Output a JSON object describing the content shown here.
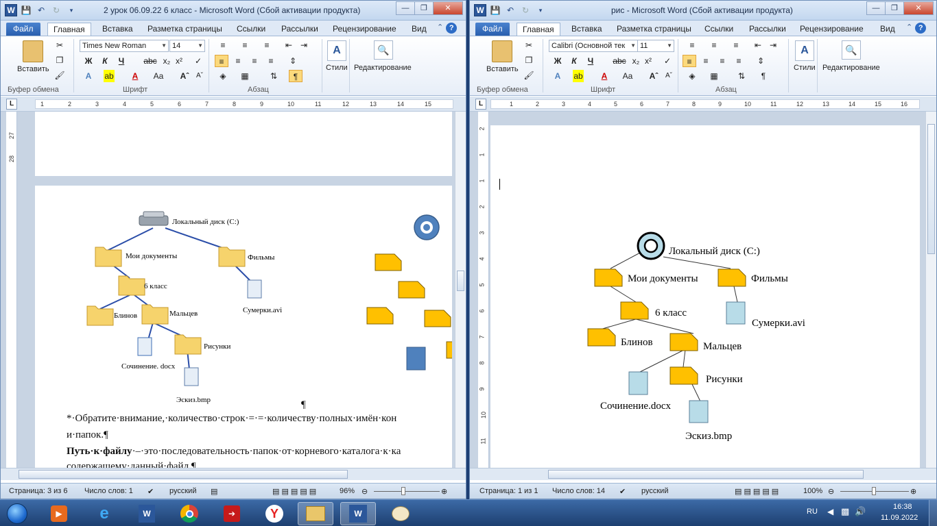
{
  "left_window": {
    "title": "2 урок 06.09.22  6 класс  -  Microsoft Word (Сбой активации продукта)",
    "tabs": [
      "Файл",
      "Главная",
      "Вставка",
      "Разметка страницы",
      "Ссылки",
      "Рассылки",
      "Рецензирование",
      "Вид"
    ],
    "active_tab": "Главная",
    "font_name": "Times New Roman",
    "font_size": "14",
    "groups": [
      "Буфер обмена",
      "Шрифт",
      "Абзац"
    ],
    "paste_label": "Вставить",
    "styles_label": "Стили",
    "editing_label": "Редактирование",
    "ruler_numbers": [
      "1",
      "2",
      "3",
      "4",
      "5",
      "6",
      "7",
      "8",
      "9",
      "10",
      "11",
      "12",
      "13",
      "14",
      "15"
    ],
    "vruler_numbers": [
      "27",
      "28"
    ],
    "diagram_labels": {
      "disk": "Локальный диск (C:)",
      "docs": "Мои документы",
      "films": "Фильмы",
      "class6": "6 класс",
      "blinov": "Блинов",
      "maltsev": "Мальцев",
      "sumerki": "Сумерки.avi",
      "sochinenie": "Сочинение. docx",
      "risunki": "Рисунки",
      "eskiz": "Эскиз.bmp"
    },
    "pilcrow": "¶",
    "doc_line1": "*·Обратите·внимание,·количество·строк·=·=·количеству·полных·имён·кон",
    "doc_line2": "и·папок.¶",
    "doc_line3_bold": "Путь·к·файлу",
    "doc_line3_rest": "·–·это·последовательность·папок·от·корневого·каталога·к·ка",
    "doc_line4": "содержащему·данный·файл.¶",
    "status": {
      "page": "Страница: 3 из 6",
      "words": "Число слов: 1",
      "lang": "русский",
      "zoom": "96%"
    }
  },
  "right_window": {
    "title": "рис  -  Microsoft Word (Сбой активации продукта)",
    "tabs": [
      "Файл",
      "Главная",
      "Вставка",
      "Разметка страницы",
      "Ссылки",
      "Рассылки",
      "Рецензирование",
      "Вид"
    ],
    "active_tab": "Главная",
    "font_name": "Calibri (Основной тек",
    "font_size": "11",
    "groups": [
      "Буфер обмена",
      "Шрифт",
      "Абзац"
    ],
    "paste_label": "Вставить",
    "styles_label": "Стили",
    "editing_label": "Редактирование",
    "ruler_numbers": [
      "1",
      "2",
      "3",
      "4",
      "5",
      "6",
      "7",
      "8",
      "9",
      "10",
      "11",
      "12",
      "13",
      "14",
      "15",
      "16"
    ],
    "vruler_numbers": [
      "2",
      "1",
      "1",
      "2",
      "3",
      "4",
      "5",
      "6",
      "7",
      "8",
      "9",
      "10",
      "11"
    ],
    "diagram_labels": {
      "disk": "Локальный диск (C:)",
      "docs": "Мои документы",
      "films": "Фильмы",
      "class6": "6 класс",
      "blinov": "Блинов",
      "maltsev": "Мальцев",
      "sumerki": "Сумерки.avi",
      "sochinenie": "Сочинение.docx",
      "risunki": "Рисунки",
      "eskiz": "Эскиз.bmp"
    },
    "status": {
      "page": "Страница: 1 из 1",
      "words": "Число слов: 14",
      "lang": "русский",
      "zoom": "100%"
    }
  },
  "taskbar": {
    "lang": "RU",
    "time": "16:38",
    "date": "11.09.2022"
  },
  "colors": {
    "folder": "#ffc000",
    "file": "#b8dce8",
    "accent": "#2b579a",
    "shape_blue": "#4f81bd"
  }
}
